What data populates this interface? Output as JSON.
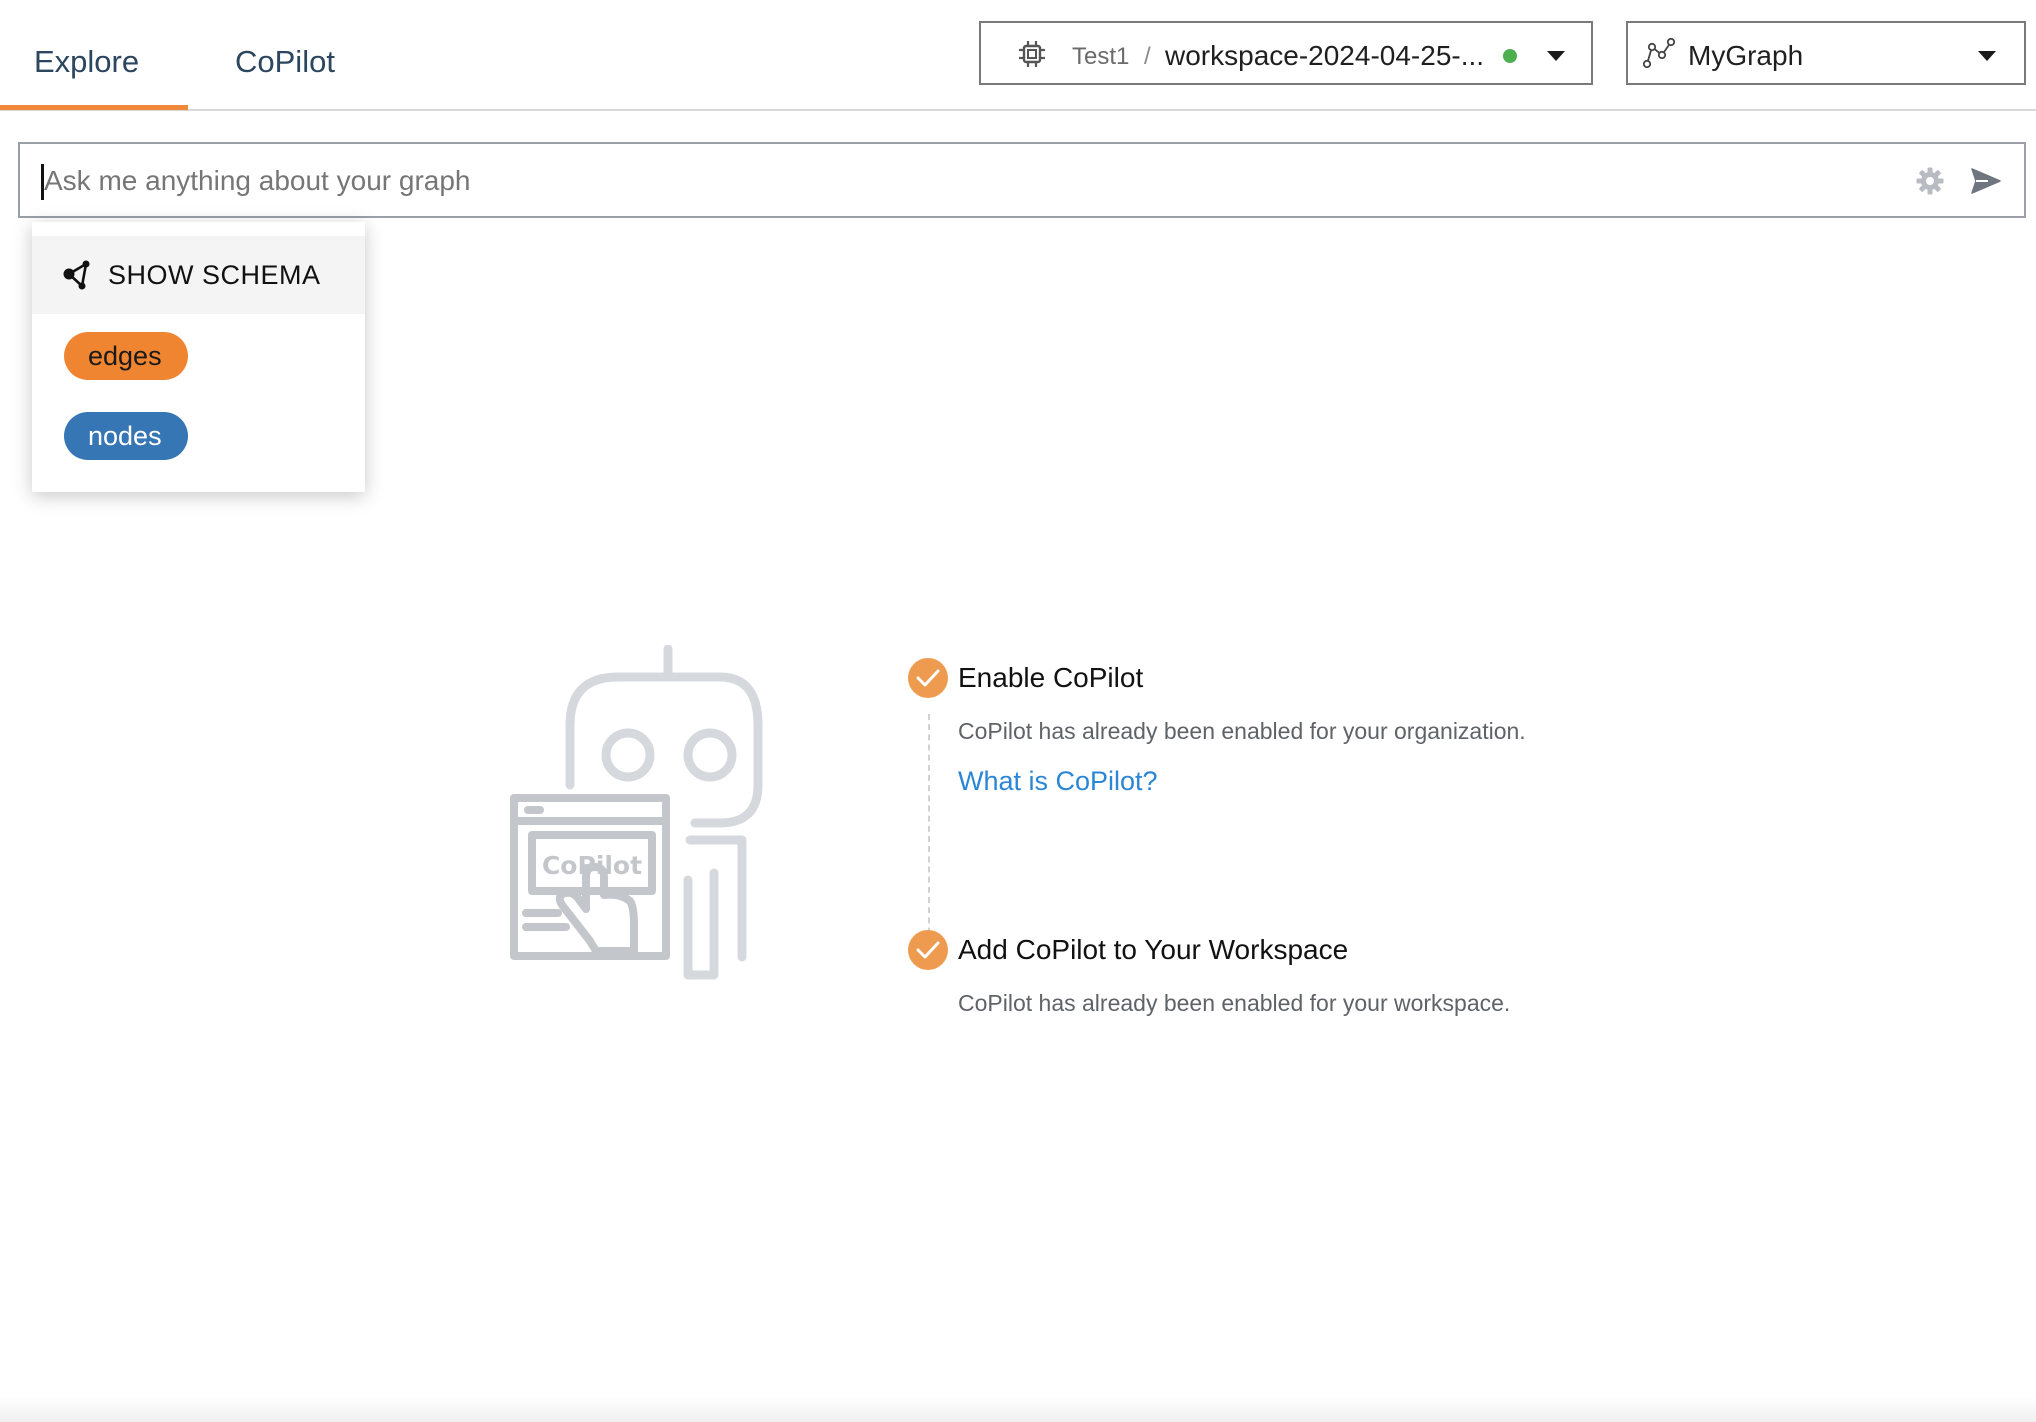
{
  "tabs": [
    {
      "label": "Explore",
      "active": true
    },
    {
      "label": "CoPilot",
      "active": false
    }
  ],
  "workspace_selector": {
    "org": "Test1",
    "separator": "/",
    "workspace": "workspace-2024-04-25-...",
    "status_color": "#4caf50",
    "icon": "chip-icon"
  },
  "graph_selector": {
    "value": "MyGraph",
    "icon": "graph-icon"
  },
  "search": {
    "placeholder": "Ask me anything about your graph",
    "value": ""
  },
  "schema_dropdown": {
    "show_schema_label": "SHOW SCHEMA",
    "items": [
      {
        "label": "edges",
        "color": "#ef8531"
      },
      {
        "label": "nodes",
        "color": "#3676b4"
      }
    ]
  },
  "illustration": {
    "label": "CoPilot"
  },
  "steps": [
    {
      "title": "Enable CoPilot",
      "description": "CoPilot has already been enabled for your organization.",
      "link": "What is CoPilot?",
      "done": true
    },
    {
      "title": "Add CoPilot to Your Workspace",
      "description": "CoPilot has already been enabled for your workspace.",
      "done": true
    }
  ],
  "colors": {
    "accent": "#f0883a",
    "link": "#2b86d6",
    "check": "#ef9b4f"
  }
}
